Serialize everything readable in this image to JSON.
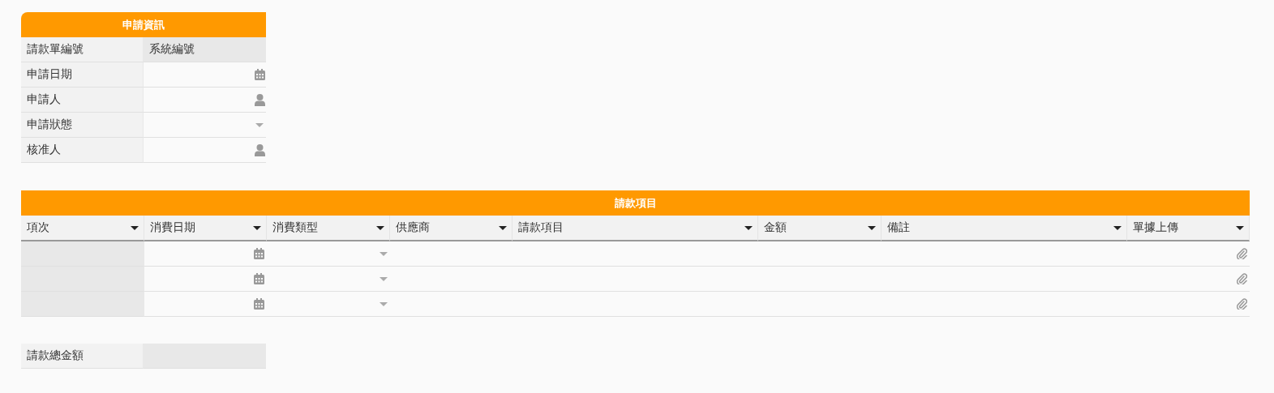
{
  "application_form": {
    "title": "申請資訊",
    "fields": [
      {
        "label": "請款單編號",
        "kind": "readonly",
        "value": "系統編號"
      },
      {
        "label": "申請日期",
        "kind": "date"
      },
      {
        "label": "申請人",
        "kind": "person"
      },
      {
        "label": "申請狀態",
        "kind": "select"
      },
      {
        "label": "核准人",
        "kind": "person"
      }
    ]
  },
  "items_table": {
    "title": "請款項目",
    "columns": [
      {
        "label": "項次"
      },
      {
        "label": "消費日期"
      },
      {
        "label": "消費類型"
      },
      {
        "label": "供應商"
      },
      {
        "label": "請款項目"
      },
      {
        "label": "金額"
      },
      {
        "label": "備註"
      },
      {
        "label": "單據上傳"
      }
    ],
    "rows": [
      {
        "cells": [
          {
            "kind": "readonly"
          },
          {
            "kind": "date"
          },
          {
            "kind": "select"
          },
          {
            "kind": "text"
          },
          {
            "kind": "text"
          },
          {
            "kind": "text"
          },
          {
            "kind": "text"
          },
          {
            "kind": "attachment"
          }
        ]
      },
      {
        "cells": [
          {
            "kind": "readonly"
          },
          {
            "kind": "date"
          },
          {
            "kind": "select"
          },
          {
            "kind": "text"
          },
          {
            "kind": "text"
          },
          {
            "kind": "text"
          },
          {
            "kind": "text"
          },
          {
            "kind": "attachment"
          }
        ]
      },
      {
        "cells": [
          {
            "kind": "readonly"
          },
          {
            "kind": "date"
          },
          {
            "kind": "select"
          },
          {
            "kind": "text"
          },
          {
            "kind": "text"
          },
          {
            "kind": "text"
          },
          {
            "kind": "text"
          },
          {
            "kind": "attachment"
          }
        ]
      }
    ]
  },
  "total": {
    "label": "請款總金額",
    "kind": "readonly"
  }
}
